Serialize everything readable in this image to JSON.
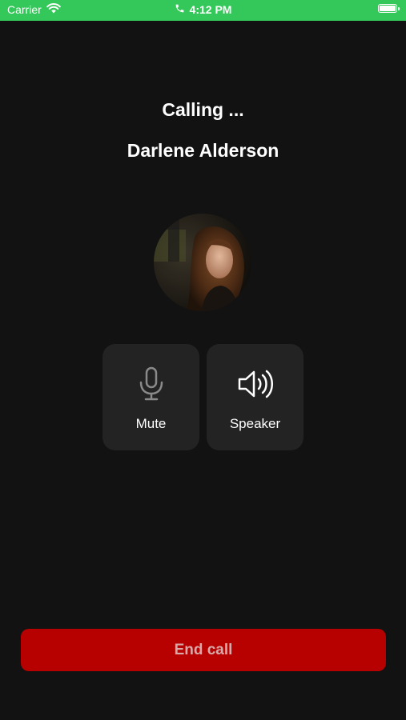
{
  "status_bar": {
    "carrier": "Carrier",
    "time": "4:12 PM",
    "color": "#34c759",
    "battery_level": 1.0
  },
  "call": {
    "status": "Calling ...",
    "contact_name": "Darlene Alderson"
  },
  "controls": [
    {
      "label": "Mute",
      "icon": "microphone-icon"
    },
    {
      "label": "Speaker",
      "icon": "speaker-icon"
    }
  ],
  "end_call": {
    "label": "End call",
    "color": "#b70101"
  }
}
